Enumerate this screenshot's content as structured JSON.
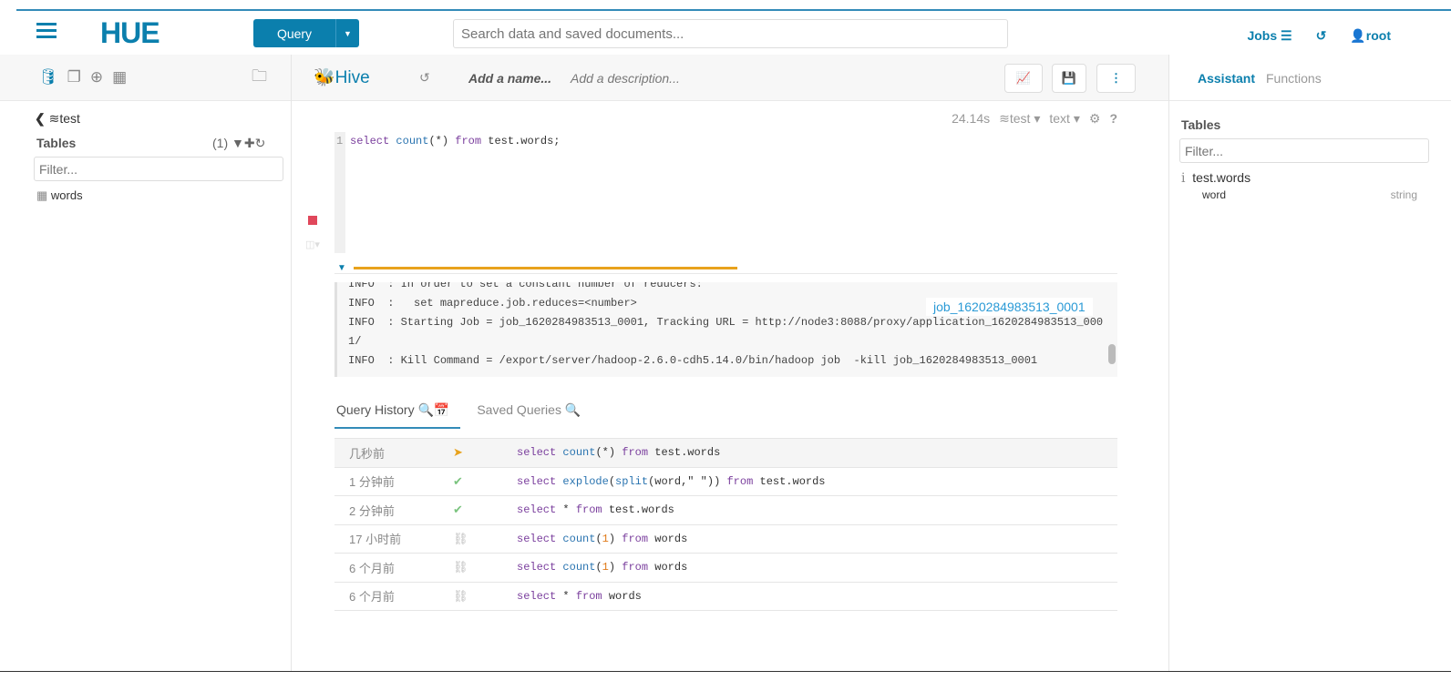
{
  "header": {
    "logo": "HUE",
    "query_button": "Query",
    "search_placeholder": "Search data and saved documents...",
    "jobs": "Jobs",
    "user": "root"
  },
  "left": {
    "db": "test",
    "tables_label": "Tables",
    "tables_count": "(1)",
    "filter_placeholder": "Filter...",
    "tables": [
      "words"
    ]
  },
  "editor": {
    "engine": "Hive",
    "name_placeholder": "Add a name...",
    "description_placeholder": "Add a description...",
    "duration": "24.14s",
    "database": "test",
    "format": "text",
    "line_number": "1",
    "query_tokens": [
      {
        "t": "select ",
        "c": "kw"
      },
      {
        "t": "count",
        "c": "fn"
      },
      {
        "t": "(*) ",
        "c": "tx"
      },
      {
        "t": "from",
        "c": "kw"
      },
      {
        "t": " test.words;",
        "c": "tx"
      }
    ],
    "progress_percent": 52,
    "progress_color": "#e8a21c"
  },
  "log": {
    "lines": [
      "INFO  : In order to set a constant number of reducers:",
      "INFO  :   set mapreduce.job.reduces=<number>",
      "INFO  : Starting Job = job_1620284983513_0001, Tracking URL = http://node3:8088/proxy/application_1620284983513_000",
      "1/",
      "INFO  : Kill Command = /export/server/hadoop-2.6.0-cdh5.14.0/bin/hadoop job  -kill job_1620284983513_0001"
    ],
    "job_link": "job_1620284983513_0001"
  },
  "tabs": {
    "history": "Query History",
    "saved": "Saved Queries"
  },
  "history": [
    {
      "time": "几秒前",
      "status": "running",
      "tokens": [
        {
          "t": "select ",
          "c": "kw"
        },
        {
          "t": "count",
          "c": "fn"
        },
        {
          "t": "(*) ",
          "c": "tx"
        },
        {
          "t": "from",
          "c": "kw"
        },
        {
          "t": " test.words",
          "c": "tx"
        }
      ]
    },
    {
      "time": "1 分钟前",
      "status": "success",
      "tokens": [
        {
          "t": "select ",
          "c": "kw"
        },
        {
          "t": "explode",
          "c": "fn"
        },
        {
          "t": "(",
          "c": "tx"
        },
        {
          "t": "split",
          "c": "fn"
        },
        {
          "t": "(word,\" \")) ",
          "c": "tx"
        },
        {
          "t": "from",
          "c": "kw"
        },
        {
          "t": " test.words",
          "c": "tx"
        }
      ]
    },
    {
      "time": "2 分钟前",
      "status": "success",
      "tokens": [
        {
          "t": "select ",
          "c": "kw"
        },
        {
          "t": "* ",
          "c": "tx"
        },
        {
          "t": "from",
          "c": "kw"
        },
        {
          "t": " test.words",
          "c": "tx"
        }
      ]
    },
    {
      "time": "17 小时前",
      "status": "expired",
      "tokens": [
        {
          "t": "select ",
          "c": "kw"
        },
        {
          "t": "count",
          "c": "fn"
        },
        {
          "t": "(",
          "c": "tx"
        },
        {
          "t": "1",
          "c": "num"
        },
        {
          "t": ") ",
          "c": "tx"
        },
        {
          "t": "from",
          "c": "kw"
        },
        {
          "t": " words",
          "c": "tx"
        }
      ]
    },
    {
      "time": "6 个月前",
      "status": "expired",
      "tokens": [
        {
          "t": "select ",
          "c": "kw"
        },
        {
          "t": "count",
          "c": "fn"
        },
        {
          "t": "(",
          "c": "tx"
        },
        {
          "t": "1",
          "c": "num"
        },
        {
          "t": ") ",
          "c": "tx"
        },
        {
          "t": "from",
          "c": "kw"
        },
        {
          "t": " words",
          "c": "tx"
        }
      ]
    },
    {
      "time": "6 个月前",
      "status": "expired",
      "tokens": [
        {
          "t": "select ",
          "c": "kw"
        },
        {
          "t": "* ",
          "c": "tx"
        },
        {
          "t": "from",
          "c": "kw"
        },
        {
          "t": " words",
          "c": "tx"
        }
      ]
    }
  ],
  "right": {
    "tab_assistant": "Assistant",
    "tab_functions": "Functions",
    "tables_label": "Tables",
    "filter_placeholder": "Filter...",
    "table": "test.words",
    "columns": [
      {
        "name": "word",
        "type": "string"
      }
    ]
  }
}
